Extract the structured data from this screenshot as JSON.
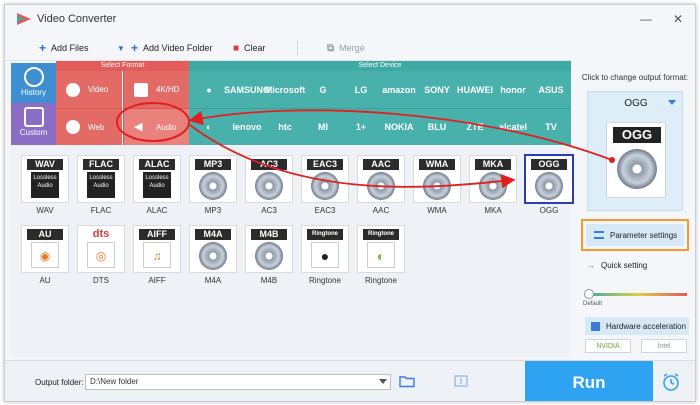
{
  "app": {
    "title": "Video Converter"
  },
  "window_controls": {
    "minimize": "—",
    "close": "✕"
  },
  "toolbar": {
    "add_files": "Add Files",
    "add_video_folder": "Add Video Folder",
    "clear": "Clear",
    "merge": "Merge"
  },
  "categories": {
    "select_format": "Select Format",
    "select_device": "Select Device",
    "history": "History",
    "custom": "Custom",
    "formats": [
      {
        "label": "Video",
        "icon": "play-icon"
      },
      {
        "label": "4K/HD",
        "icon": "4k-icon"
      },
      {
        "label": "Web",
        "icon": "chrome-icon"
      },
      {
        "label": "Audio",
        "icon": "speaker-icon"
      }
    ],
    "devices_row1": [
      "",
      "SAMSUNG",
      "Microsoft",
      "G",
      "LG",
      "amazon",
      "SONY",
      "HUAWEI",
      "honor",
      "ASUS"
    ],
    "devices_row2": [
      "",
      "lenovo",
      "htc",
      "MI",
      "1+",
      "NOKIA",
      "BLU",
      "ZTE",
      "alcatel",
      "TV"
    ]
  },
  "formats_row1": [
    {
      "label": "WAV",
      "tag": "WAV",
      "style": "lossless"
    },
    {
      "label": "FLAC",
      "tag": "FLAC",
      "style": "lossless"
    },
    {
      "label": "ALAC",
      "tag": "ALAC",
      "style": "lossless"
    },
    {
      "label": "MP3",
      "tag": "MP3",
      "style": "disc"
    },
    {
      "label": "AC3",
      "tag": "AC3",
      "style": "disc"
    },
    {
      "label": "EAC3",
      "tag": "EAC3",
      "style": "disc"
    },
    {
      "label": "AAC",
      "tag": "AAC",
      "style": "disc"
    },
    {
      "label": "WMA",
      "tag": "WMA",
      "style": "disc"
    },
    {
      "label": "MKA",
      "tag": "MKA",
      "style": "disc"
    },
    {
      "label": "OGG",
      "tag": "OGG",
      "style": "disc"
    }
  ],
  "formats_row2": [
    {
      "label": "AU",
      "tag": "AU",
      "style": "au"
    },
    {
      "label": "DTS",
      "tag": "dts",
      "style": "dts"
    },
    {
      "label": "AIFF",
      "tag": "AIFF",
      "style": "aiff"
    },
    {
      "label": "M4A",
      "tag": "M4A",
      "style": "disc"
    },
    {
      "label": "M4B",
      "tag": "M4B",
      "style": "disc"
    },
    {
      "label": "Ringtone",
      "tag": "Ringtone",
      "style": "apple"
    },
    {
      "label": "Ringtone",
      "tag": "Ringtone",
      "style": "android"
    }
  ],
  "lossless_text": "Lossless Audio",
  "right_panel": {
    "caption": "Click to change output format:",
    "selected_format": "OGG",
    "parameter_settings": "Parameter settings",
    "quick_setting": "Quick setting",
    "default_label": "Default",
    "hardware_acceleration": "Hardware acceleration",
    "nvidia": "NVIDIA",
    "intel": "Intel"
  },
  "bottom": {
    "output_folder_label": "Output folder:",
    "output_folder_value": "D:\\New folder",
    "run": "Run"
  },
  "colors": {
    "format_red": "#e46a66",
    "device_teal": "#49b1ab",
    "history_blue": "#3d8fd1",
    "custom_purple": "#8b6dc6",
    "run_blue": "#2ea3f2",
    "annotation_red": "#e02020",
    "highlight_orange": "#f29a2e"
  }
}
